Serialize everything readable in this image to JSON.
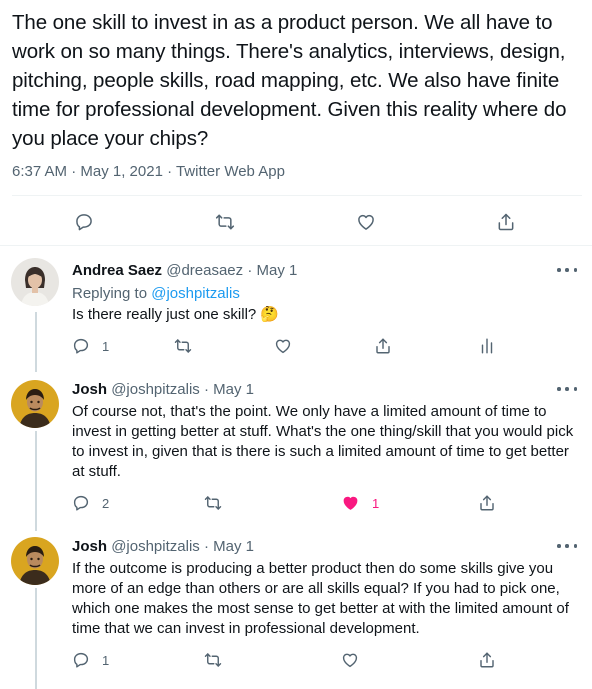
{
  "main_tweet": {
    "text": "The one skill to invest in as a product person. We all have to work on so many things. There's analytics, interviews, design, pitching, people skills, road mapping, etc.  We also have finite time for professional development. Given this reality where do you place your chips?",
    "timestamp": "6:37 AM · May 1, 2021 · Twitter Web App",
    "actions": [
      "reply-icon",
      "retweet-icon",
      "like-icon",
      "share-icon"
    ]
  },
  "replies": [
    {
      "name": "Andrea Saez",
      "handle_date": "@dreasaez · May 1",
      "replying_prefix": "Replying to ",
      "replying_to": "@joshpitzalis",
      "text": "Is there really just one skill? 🤔",
      "reply_count": "1",
      "like_count": "",
      "liked": false,
      "avatar": "avatar-woman"
    },
    {
      "name": "Josh",
      "handle_date": "@joshpitzalis · May 1",
      "text": "Of course not, that's the point. We only have a limited amount of time to invest in getting better at stuff. What's the one thing/skill that you would pick to invest in, given that is there is such a limited amount of time to get better at stuff.",
      "reply_count": "2",
      "like_count": "1",
      "liked": true,
      "avatar": "avatar-man"
    },
    {
      "name": "Josh",
      "handle_date": "@joshpitzalis · May 1",
      "text": "If the outcome is producing a better product then do some skills give you more of an edge than others or are all skills equal? If you had to pick one, which one makes the most sense to get better at with the limited amount of time that we can invest in professional development.",
      "reply_count": "1",
      "like_count": "",
      "liked": false,
      "avatar": "avatar-man"
    }
  ],
  "colors": {
    "text": "#0f1419",
    "secondary": "#536471",
    "link": "#1d9bf0",
    "like": "#f91880",
    "border": "#eff3f4"
  }
}
